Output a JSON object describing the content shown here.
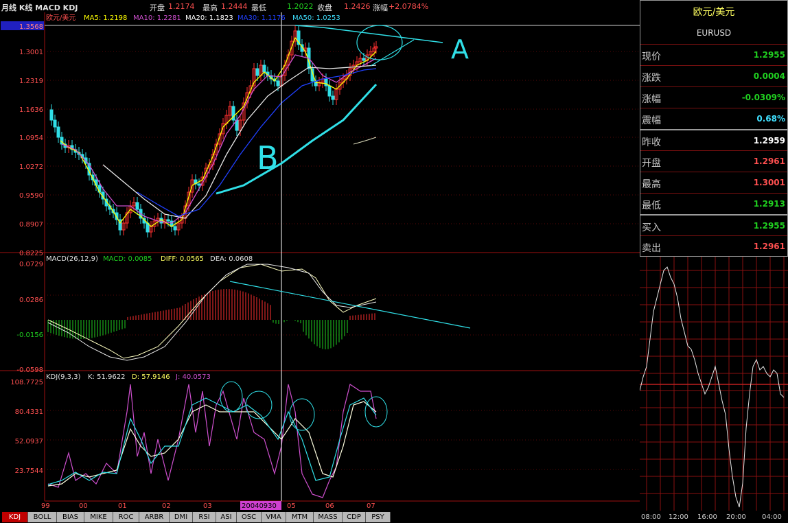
{
  "header": {
    "title": "月线 K线 MACD KDJ",
    "open_label": "开盘",
    "open_value": "1.2174",
    "high_label": "最高",
    "high_value": "1.2444",
    "low_label": "最低",
    "low_value": "1.2022",
    "close_label": "收盘",
    "close_value": "1.2426",
    "change_label": "涨幅",
    "change_value": "+2.0784%"
  },
  "main_chart": {
    "symbol": "欧元/美元",
    "ma": [
      {
        "label": "MA5: 1.2198",
        "color": "#ffff00"
      },
      {
        "label": "MA10: 1.2281",
        "color": "#d050d0"
      },
      {
        "label": "MA20: 1.1823",
        "color": "#ffffff"
      },
      {
        "label": "MA30: 1.1176",
        "color": "#2040ff"
      },
      {
        "label": "MA50: 1.0253",
        "color": "#40e0ff"
      }
    ],
    "y_ticks": [
      "1.3568",
      "1.3001",
      "1.2319",
      "1.1636",
      "1.0954",
      "1.0272",
      "0.9590",
      "0.8907",
      "0.8225"
    ],
    "annotations": {
      "a": "A",
      "b": "B"
    }
  },
  "macd": {
    "title": "MACD(26,12,9)",
    "macd_label": "MACD: 0.0085",
    "diff_label": "DIFF: 0.0565",
    "dea_label": "DEA: 0.0608",
    "y_ticks": [
      "0.0729",
      "0.0286",
      "-0.0156",
      "-0.0598"
    ]
  },
  "kdj": {
    "title": "KDJ(9,3,3)",
    "k_label": "K: 51.9622",
    "d_label": "D: 57.9146",
    "j_label": "J: 40.0573",
    "y_ticks": [
      "108.7725",
      "80.4331",
      "52.0937",
      "23.7544"
    ]
  },
  "x_axis": {
    "labels": [
      "99",
      "00",
      "01",
      "02",
      "03",
      "05",
      "06",
      "07"
    ],
    "cursor_date": "20040930"
  },
  "tabs": [
    "KDJ",
    "BOLL",
    "BIAS",
    "MIKE",
    "ROC",
    "ARBR",
    "DMI",
    "RSI",
    "ASI",
    "OSC",
    "VMA",
    "MTM",
    "MASS",
    "CDP",
    "PSY"
  ],
  "quote_panel": {
    "name": "欧元/美元",
    "code": "EURUSD",
    "rows": [
      {
        "label": "现价",
        "value": "1.2955",
        "color": "#20d020"
      },
      {
        "label": "涨跌",
        "value": "0.0004",
        "color": "#20d020"
      },
      {
        "label": "涨幅",
        "value": "-0.0309%",
        "color": "#20d020"
      },
      {
        "label": "震幅",
        "value": "0.68%",
        "color": "#40e0ff"
      },
      {
        "label": "昨收",
        "value": "1.2959",
        "color": "#ffffff"
      },
      {
        "label": "开盘",
        "value": "1.2961",
        "color": "#ff5050"
      },
      {
        "label": "最高",
        "value": "1.3001",
        "color": "#ff5050"
      },
      {
        "label": "最低",
        "value": "1.2913",
        "color": "#20d020"
      },
      {
        "label": "买入",
        "value": "1.2955",
        "color": "#20d020"
      },
      {
        "label": "卖出",
        "value": "1.2961",
        "color": "#ff5050"
      }
    ]
  },
  "intraday": {
    "x_labels": [
      "08:00",
      "12:00",
      "16:00",
      "20:00",
      "04:00"
    ]
  }
}
